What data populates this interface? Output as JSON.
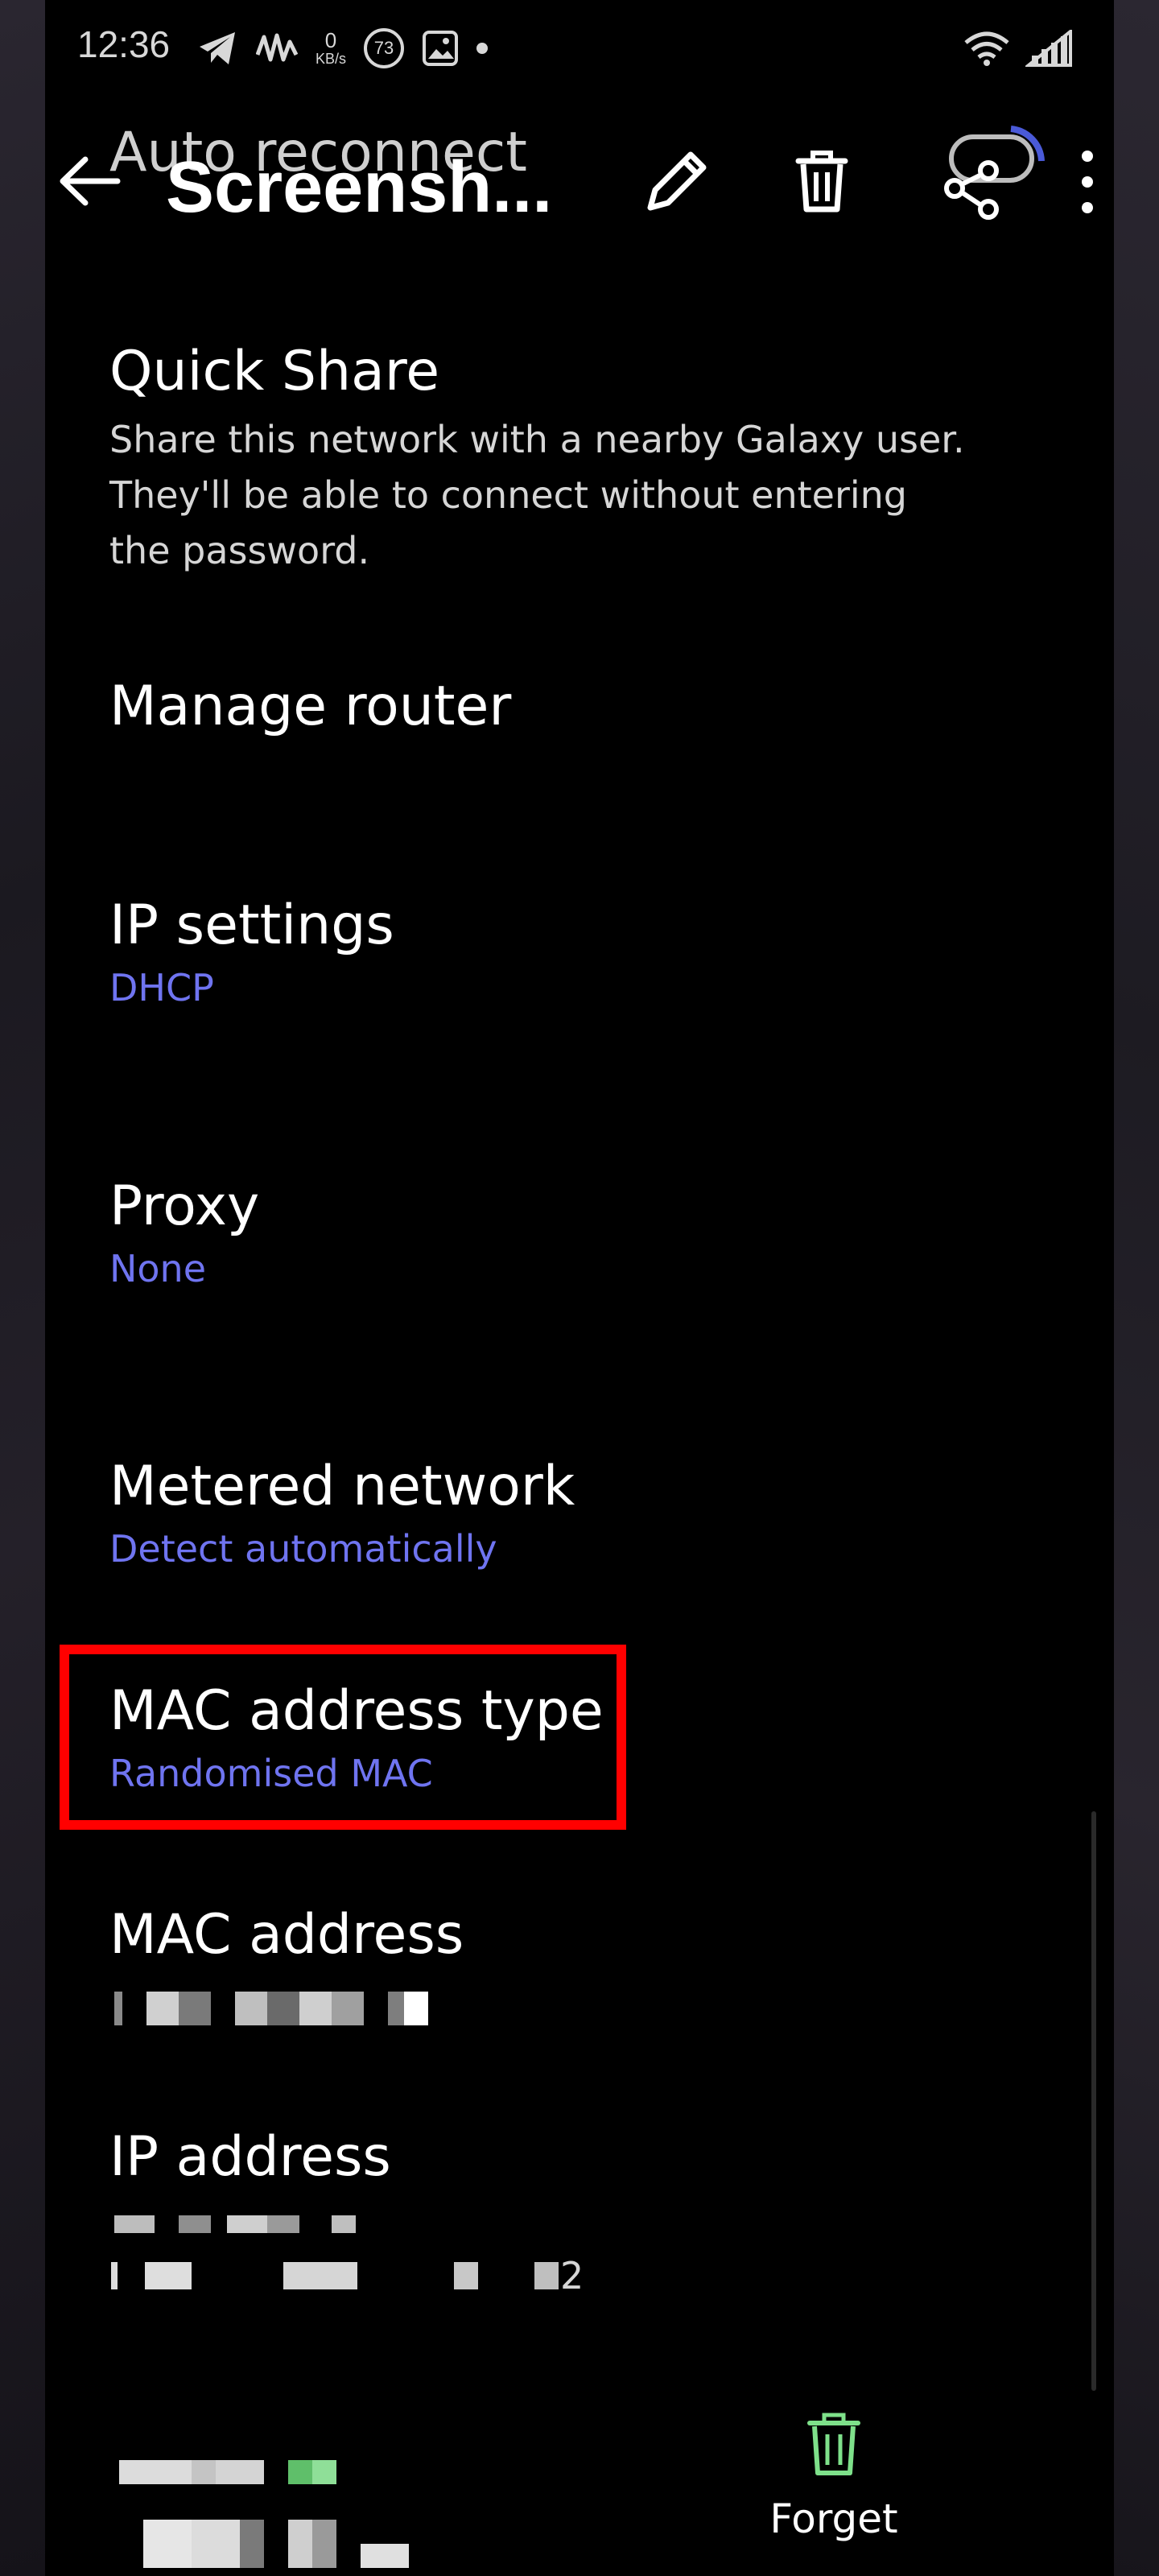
{
  "status_bar": {
    "time": "12:36",
    "kb_value": "0",
    "kb_unit": "KB/s",
    "notification_count": "73"
  },
  "app_bar": {
    "background_title": "Auto reconnect",
    "viewer_title": "Screensh...",
    "icons": [
      "back-arrow-icon",
      "pencil-icon",
      "trash-icon",
      "share-icon",
      "more-vert-icon"
    ]
  },
  "settings": {
    "quick_share": {
      "title": "Quick Share",
      "description_lines": [
        "Share this network with a nearby Galaxy user.",
        "They'll be able to connect without entering",
        "the password."
      ]
    },
    "manage_router": {
      "title": "Manage router"
    },
    "ip_settings": {
      "title": "IP settings",
      "value": "DHCP"
    },
    "proxy": {
      "title": "Proxy",
      "value": "None"
    },
    "metered_network": {
      "title": "Metered network",
      "value": "Detect automatically"
    },
    "mac_address_type": {
      "title": "MAC address type",
      "value": "Randomised MAC"
    },
    "mac_address": {
      "title": "MAC address"
    },
    "ip_address": {
      "title": "IP address",
      "value_tail": "2"
    }
  },
  "bottom_bar": {
    "forget_label": "Forget"
  },
  "colors": {
    "accent": "#6f74f0",
    "highlight": "#ff0000",
    "forget_icon": "#7ee08a"
  }
}
